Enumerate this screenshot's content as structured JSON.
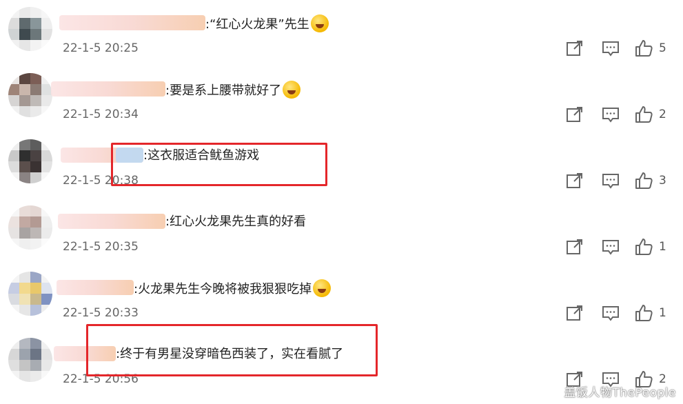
{
  "comments": [
    {
      "text": ":“红心火龙果”先生",
      "emoji": "laughing-tears-emoji",
      "time": "22-1-5 20:25",
      "likes": "5"
    },
    {
      "text": ":要是系上腰带就好了",
      "emoji": "crying-emoji",
      "time": "22-1-5 20:34",
      "likes": "2"
    },
    {
      "text": ":这衣服适合鱿鱼游戏",
      "emoji": "",
      "time": "22-1-5 20:38",
      "likes": "3"
    },
    {
      "text": ":红心火龙果先生真的好看",
      "emoji": "",
      "time": "22-1-5 20:35",
      "likes": "1"
    },
    {
      "text": ":火龙果先生今晚将被我狠狠吃掉",
      "emoji": "screaming-emoji",
      "time": "22-1-5 20:33",
      "likes": "1"
    },
    {
      "text": ":终于有男星没穿暗色西装了，实在看腻了",
      "emoji": "",
      "time": "22-1-5 20:56",
      "likes": "2"
    }
  ],
  "highlight_color": "#e4262a",
  "watermark": "盖饭人物ThePeople"
}
